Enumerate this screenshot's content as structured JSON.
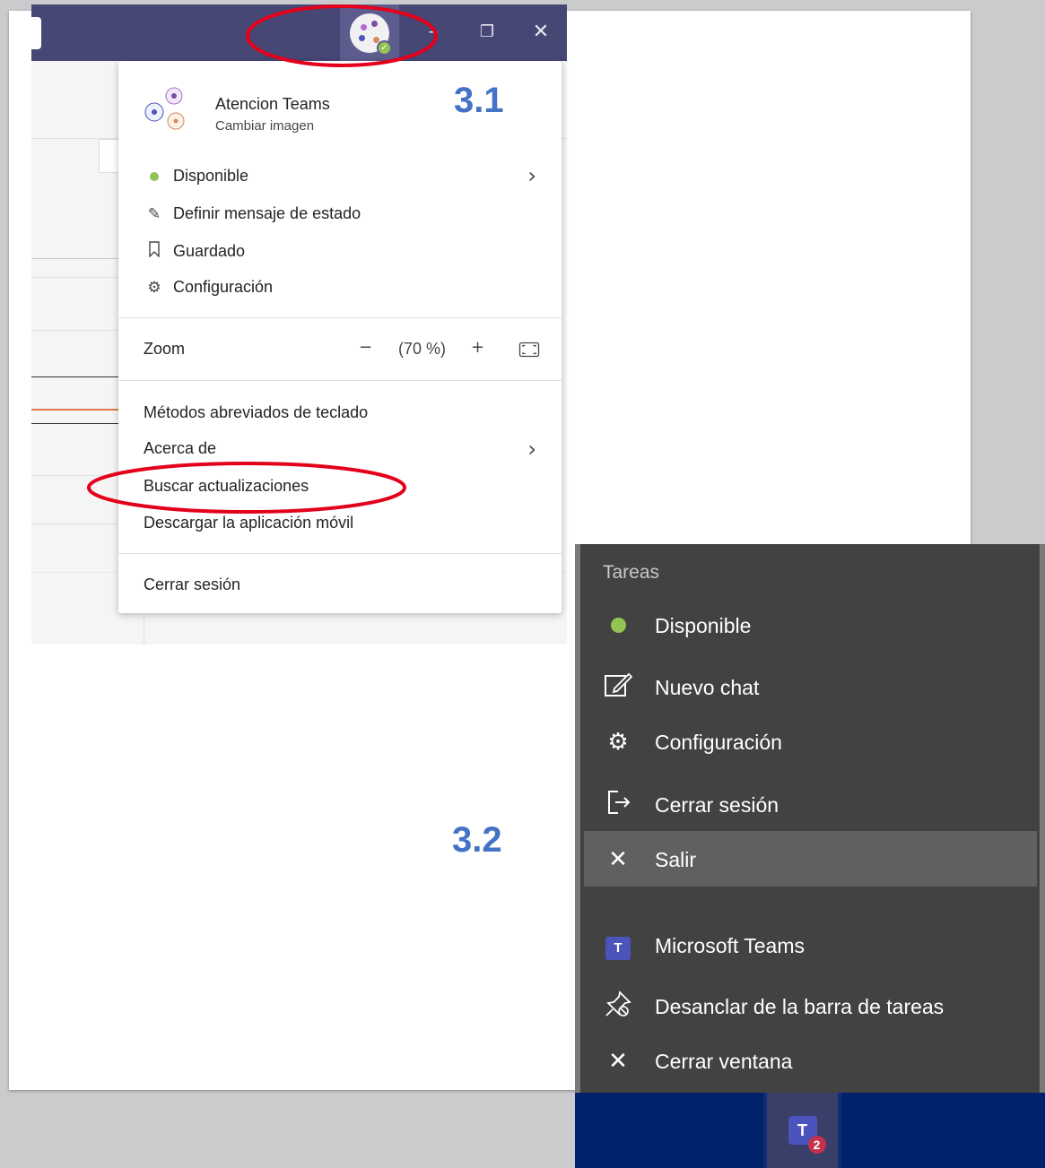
{
  "colors": {
    "teams_titlebar": "#464775",
    "presence_available": "#92c353",
    "annotation_red": "#e3001b",
    "label_blue": "#4472c4",
    "jumplist_bg": "#424242",
    "taskbar_bg": "#00226b"
  },
  "labels": {
    "step_1": "3.1",
    "step_2": "3.2"
  },
  "teams_window": {
    "window_controls": {
      "minimize_icon": "minimize-icon",
      "maximize_icon": "restore-icon",
      "close_icon": "close-icon"
    }
  },
  "profile_menu": {
    "user_name": "Atencion Teams",
    "change_picture": "Cambiar imagen",
    "items_top": [
      {
        "label": "Disponible",
        "icon": "presence-dot",
        "has_submenu": true
      },
      {
        "label": "Definir mensaje de estado",
        "icon": "edit-message-icon"
      },
      {
        "label": "Guardado",
        "icon": "bookmark-icon"
      },
      {
        "label": "Configuración",
        "icon": "gear-icon"
      }
    ],
    "zoom": {
      "label": "Zoom",
      "minus": "−",
      "value": "(70 %)",
      "plus": "+",
      "fullscreen_icon": "fullscreen-icon"
    },
    "items_bottom": [
      {
        "label": "Métodos abreviados de teclado"
      },
      {
        "label": "Acerca de",
        "has_submenu": true
      },
      {
        "label": "Buscar actualizaciones"
      },
      {
        "label": "Descargar la aplicación móvil"
      }
    ],
    "sign_out": "Cerrar sesión"
  },
  "jump_list": {
    "header": "Tareas",
    "tasks": [
      {
        "label": "Disponible",
        "icon": "presence-dot"
      },
      {
        "label": "Nuevo chat",
        "icon": "compose-icon"
      },
      {
        "label": "Configuración",
        "icon": "gear-icon"
      },
      {
        "label": "Cerrar sesión",
        "icon": "sign-out-icon"
      },
      {
        "label": "Salir",
        "icon": "close-icon"
      }
    ],
    "app_items": [
      {
        "label": "Microsoft Teams",
        "icon": "teams-icon"
      },
      {
        "label": "Desanclar de la barra de tareas",
        "icon": "unpin-icon"
      },
      {
        "label": "Cerrar ventana",
        "icon": "close-icon"
      }
    ]
  },
  "taskbar": {
    "teams_badge": "2",
    "teams_letter": "T"
  }
}
